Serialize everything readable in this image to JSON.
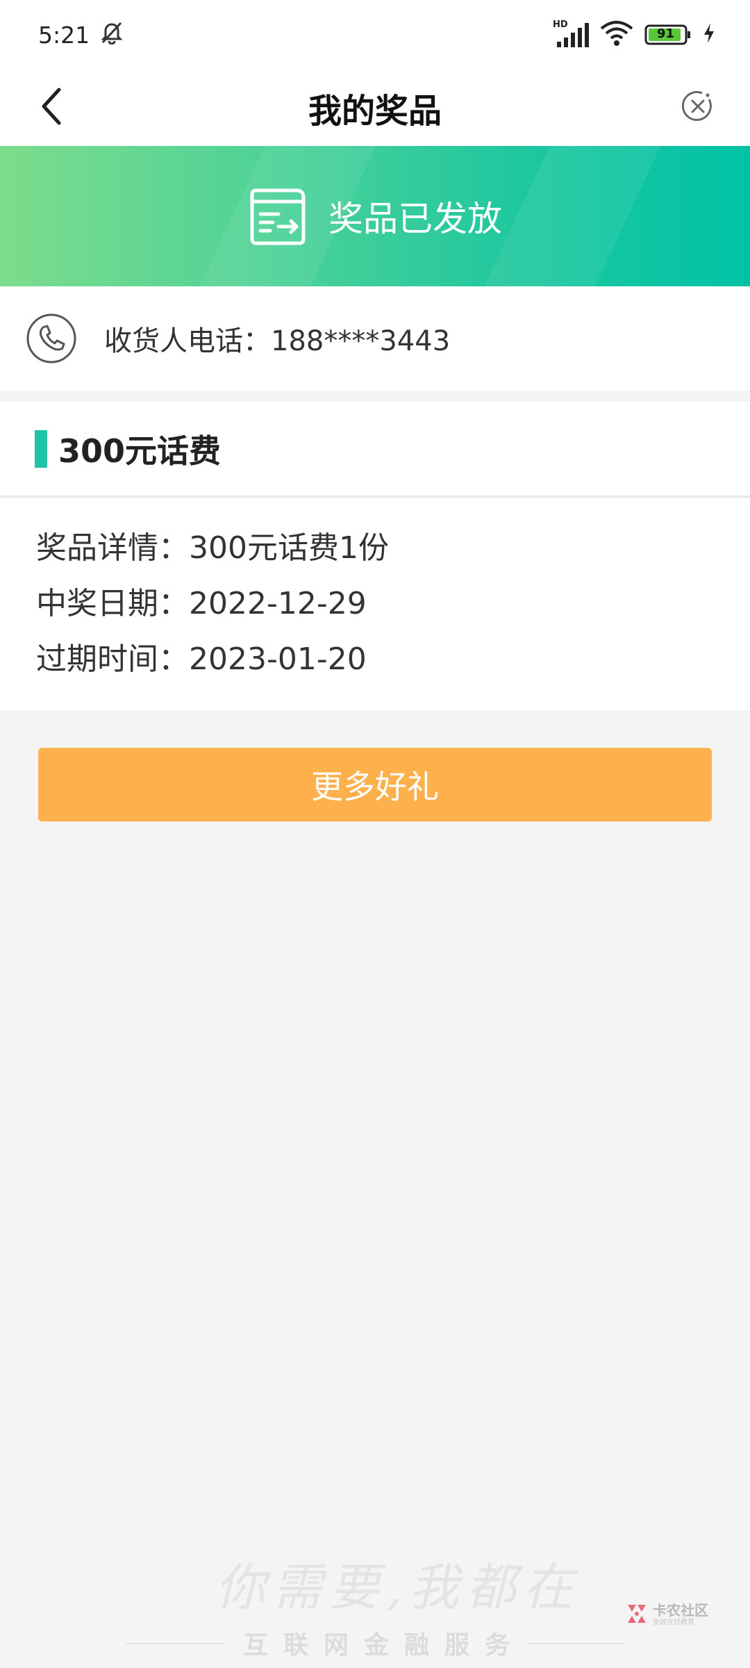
{
  "status_bar": {
    "time": "5:21",
    "network_label": "HD",
    "battery": "91",
    "colors": {
      "battery_fill": "#5cc63a"
    }
  },
  "nav": {
    "title": "我的奖品",
    "back_icon": "chevron-left-icon",
    "close_icon": "close-circle-icon"
  },
  "banner": {
    "status_text": "奖品已发放",
    "icon": "delivery-box-icon",
    "colors": {
      "start": "#7ddc8c",
      "end": "#00c3a6"
    }
  },
  "contact": {
    "icon": "phone-icon",
    "phone_label": "收货人电话：188****3443"
  },
  "prize": {
    "title": "300元话费",
    "details": [
      "奖品详情：300元话费1份",
      "中奖日期：2022-12-29",
      "过期时间：2023-01-20"
    ],
    "accent_color": "#1ec4a4"
  },
  "actions": {
    "more_gifts_label": "更多好礼",
    "button_color": "#fdb04c"
  },
  "watermark": {
    "slogan": "你需要,我都在",
    "subtitle": "互联网金融服务",
    "brand_name": "卡农社区",
    "brand_sub": "金融在线教育"
  }
}
